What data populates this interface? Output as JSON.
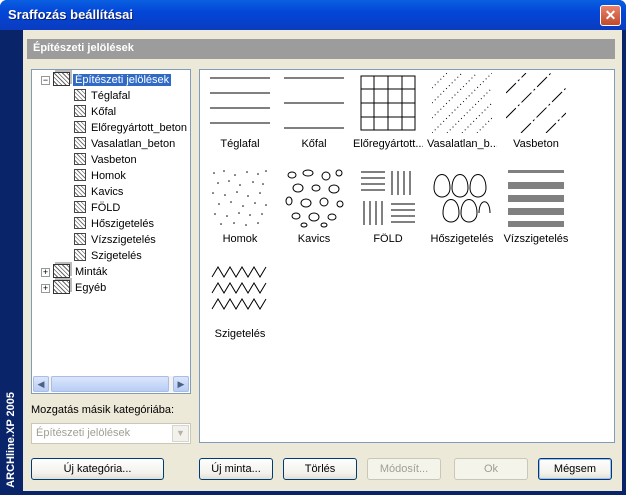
{
  "window": {
    "title": "Sraffozás beállításai"
  },
  "sidebar": {
    "product_label": "ARCHline.XP 2005"
  },
  "section": {
    "header": "Építészeti jelölések"
  },
  "tree": {
    "root": "Építészeti jelölések",
    "children": [
      "Téglafal",
      "Kőfal",
      "Előregyártott_beton",
      "Vasalatlan_beton",
      "Vasbeton",
      "Homok",
      "Kavics",
      "FÖLD",
      "Hőszigetelés",
      "Vízszigetelés",
      "Szigetelés"
    ],
    "groups": [
      "Minták",
      "Egyéb"
    ]
  },
  "move": {
    "label": "Mozgatás másik kategóriába:",
    "selected": "Építészeti jelölések"
  },
  "patterns": [
    {
      "label": "Téglafal",
      "icon": "horizontal-lines"
    },
    {
      "label": "Kőfal",
      "icon": "spaced-lines"
    },
    {
      "label": "Előregyártott...",
      "icon": "grid"
    },
    {
      "label": "Vasalatlan_b...",
      "icon": "dotted-diagonal"
    },
    {
      "label": "Vasbeton",
      "icon": "dashed-diagonal"
    },
    {
      "label": "Homok",
      "icon": "sand-dots"
    },
    {
      "label": "Kavics",
      "icon": "gravel-circles"
    },
    {
      "label": "FÖLD",
      "icon": "basket-weave"
    },
    {
      "label": "Hőszigetelés",
      "icon": "loops"
    },
    {
      "label": "Vízszigetelés",
      "icon": "thick-bars"
    },
    {
      "label": "Szigetelés",
      "icon": "zigzag"
    }
  ],
  "buttons": {
    "new_category": "Új kategória...",
    "new_pattern": "Új minta...",
    "delete": "Törlés",
    "modify": "Módosít...",
    "ok": "Ok",
    "cancel": "Mégsem"
  },
  "colors": {
    "title_bar": "#0a5fe0",
    "selection": "#316ac5",
    "header_bar": "#9c9c9c"
  }
}
